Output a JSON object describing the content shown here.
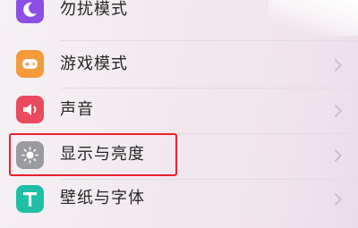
{
  "settings": {
    "items": [
      {
        "label": "勿扰模式",
        "icon": "moon-icon",
        "icon_color": "#8c4fe6"
      },
      {
        "label": "游戏模式",
        "icon": "gamepad-icon",
        "icon_color": "#f49a3b"
      },
      {
        "label": "声音",
        "icon": "speaker-icon",
        "icon_color": "#ea4a5e"
      },
      {
        "label": "显示与亮度",
        "icon": "brightness-icon",
        "icon_color": "#9b9aa1"
      },
      {
        "label": "壁纸与字体",
        "icon": "text-t-icon",
        "icon_color": "#1fbfa5"
      }
    ]
  },
  "highlight_color": "#e8212a"
}
